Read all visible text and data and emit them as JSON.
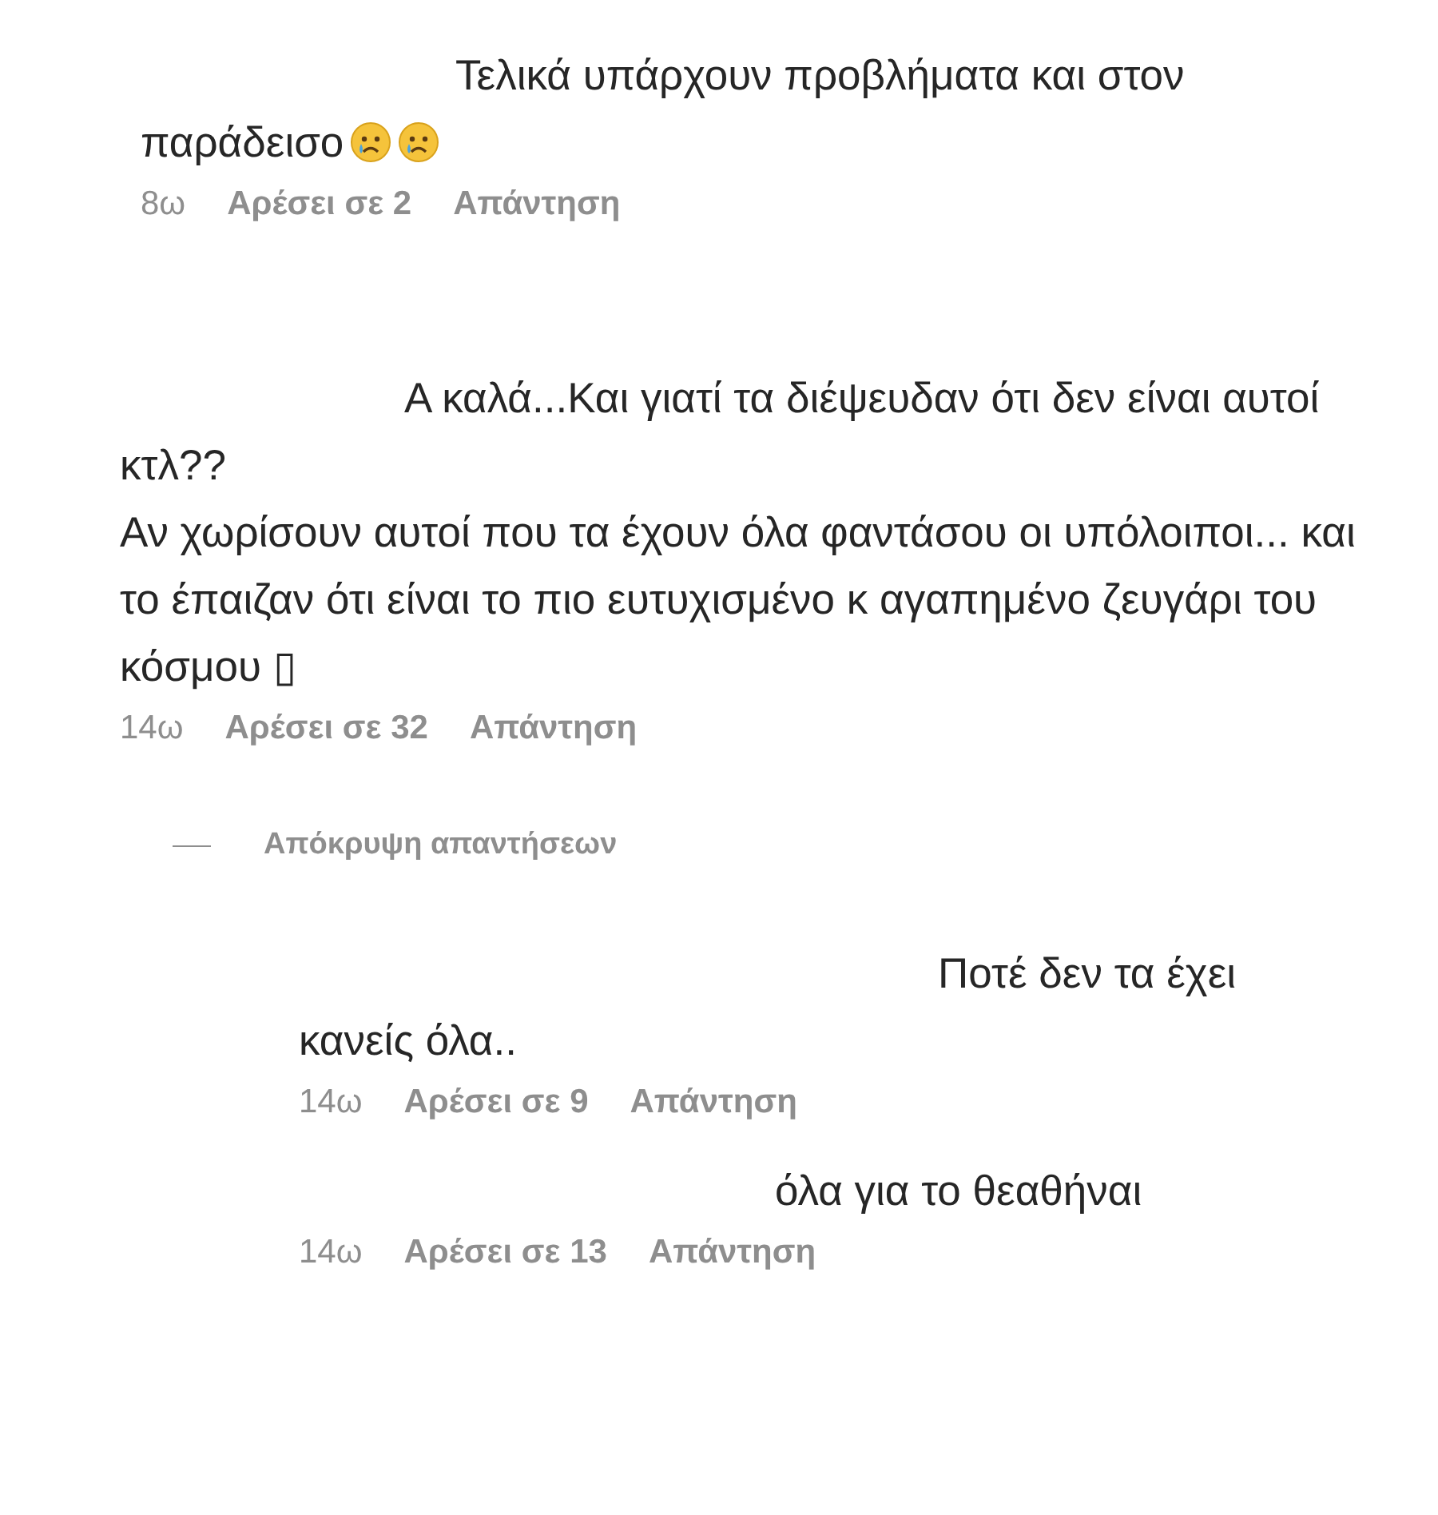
{
  "comments": [
    {
      "text": "Τελικά υπάρχουν προβλήματα και στον παράδεισο",
      "emojis": [
        {
          "kind": "crying"
        },
        {
          "kind": "crying"
        }
      ],
      "time": "8ω",
      "likes": "Αρέσει σε 2",
      "reply": "Απάντηση"
    },
    {
      "text": "Α καλά...Και γιατί τα διέψευδαν ότι δεν είναι αυτοί κτλ??\nΑν χωρίσουν αυτοί που τα έχουν όλα φαντάσου οι υπόλοιποι... και το έπαιζαν ότι είναι το πιο ευτυχισμένο κ αγαπημένο ζευγάρι του κόσμου ▯",
      "time": "14ω",
      "likes": "Αρέσει σε 32",
      "reply": "Απάντηση",
      "hide_replies": "Απόκρυψη απαντήσεων",
      "replies": [
        {
          "text": "Ποτέ δεν τα έχει κανείς όλα..",
          "time": "14ω",
          "likes": "Αρέσει σε 9",
          "reply": "Απάντηση"
        },
        {
          "text": "όλα για το θεαθήναι",
          "time": "14ω",
          "likes": "Αρέσει σε 13",
          "reply": "Απάντηση"
        }
      ]
    }
  ]
}
